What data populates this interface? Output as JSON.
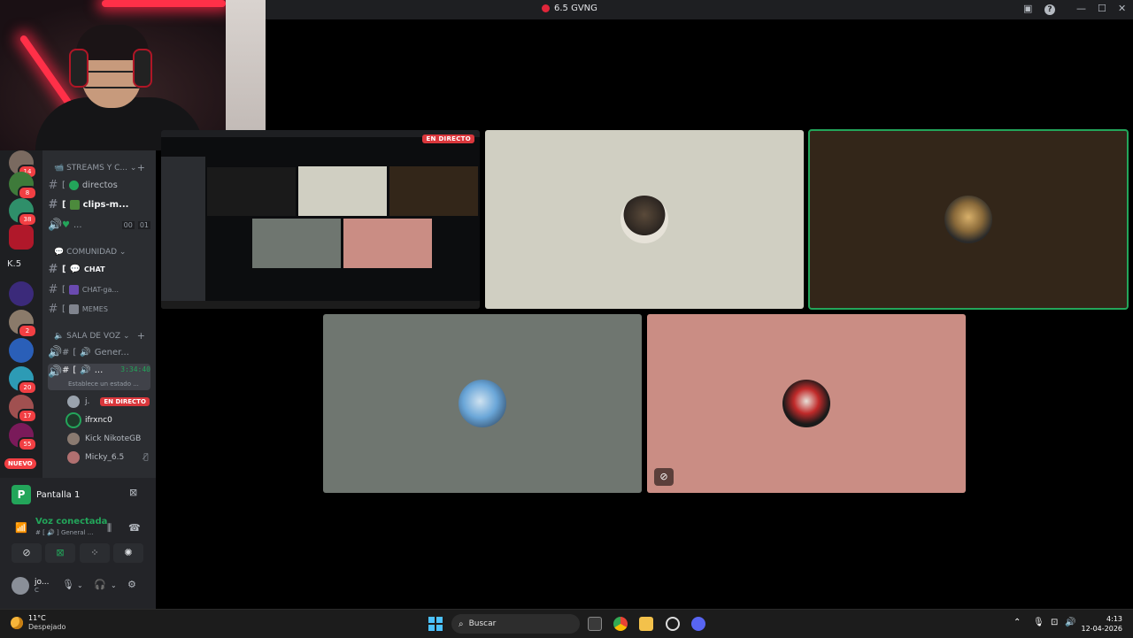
{
  "window": {
    "title": "6.5 GVNG"
  },
  "server_badges": [
    "14",
    "8",
    "38",
    "2",
    "20",
    "17",
    "55"
  ],
  "server_label": "K.5",
  "new_badge": "NUEVO",
  "categories": {
    "streams": "STREAMS Y C...",
    "comunidad": "COMUNIDAD",
    "voz": "SALA DE VOZ"
  },
  "channels": {
    "directos": "directos",
    "clips": "clips-m...",
    "voice_1_counts": [
      "00",
      "01"
    ],
    "chat": "CHAT",
    "chat_ga": "CHAT-ga...",
    "memes": "MEMES",
    "general": "Gener...",
    "active_voice": "...",
    "active_voice_timer": "3:34:40",
    "active_voice_status": "Establece un estado ..."
  },
  "voice_users": [
    {
      "name": "j.",
      "live": "EN DIRECTO"
    },
    {
      "name": "ifrxnc0"
    },
    {
      "name": "Kick NikoteGB"
    },
    {
      "name": "Micky_6.5"
    }
  ],
  "stream_panel": {
    "source": "Pantalla 1",
    "status": "Voz conectada",
    "channel": "# [ 🔊 ] General ..."
  },
  "user": {
    "name": "jo...",
    "sub": "C"
  },
  "stream": {
    "live_label": "EN DIRECTO"
  },
  "colors": {
    "tile_cream": "#d0cfc2",
    "tile_dark": "#332619",
    "tile_gray": "#6f7670",
    "tile_pink": "#ca8d84",
    "speaking": "#23a55a",
    "live": "#da373c"
  },
  "taskbar": {
    "temp": "11°C",
    "weather": "Despejado",
    "search": "Buscar",
    "time": "4:13",
    "date": "12-04-2026"
  }
}
